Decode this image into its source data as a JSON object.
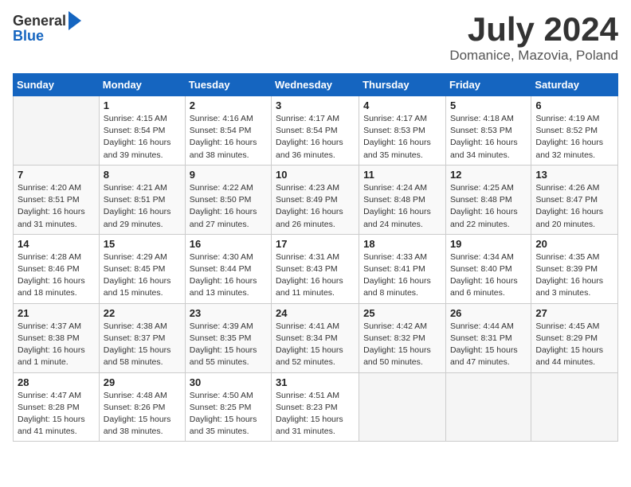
{
  "header": {
    "logo_line1": "General",
    "logo_line2": "Blue",
    "title": "July 2024",
    "location": "Domanice, Mazovia, Poland"
  },
  "calendar": {
    "days_of_week": [
      "Sunday",
      "Monday",
      "Tuesday",
      "Wednesday",
      "Thursday",
      "Friday",
      "Saturday"
    ],
    "weeks": [
      [
        {
          "num": "",
          "detail": ""
        },
        {
          "num": "1",
          "detail": "Sunrise: 4:15 AM\nSunset: 8:54 PM\nDaylight: 16 hours\nand 39 minutes."
        },
        {
          "num": "2",
          "detail": "Sunrise: 4:16 AM\nSunset: 8:54 PM\nDaylight: 16 hours\nand 38 minutes."
        },
        {
          "num": "3",
          "detail": "Sunrise: 4:17 AM\nSunset: 8:54 PM\nDaylight: 16 hours\nand 36 minutes."
        },
        {
          "num": "4",
          "detail": "Sunrise: 4:17 AM\nSunset: 8:53 PM\nDaylight: 16 hours\nand 35 minutes."
        },
        {
          "num": "5",
          "detail": "Sunrise: 4:18 AM\nSunset: 8:53 PM\nDaylight: 16 hours\nand 34 minutes."
        },
        {
          "num": "6",
          "detail": "Sunrise: 4:19 AM\nSunset: 8:52 PM\nDaylight: 16 hours\nand 32 minutes."
        }
      ],
      [
        {
          "num": "7",
          "detail": "Sunrise: 4:20 AM\nSunset: 8:51 PM\nDaylight: 16 hours\nand 31 minutes."
        },
        {
          "num": "8",
          "detail": "Sunrise: 4:21 AM\nSunset: 8:51 PM\nDaylight: 16 hours\nand 29 minutes."
        },
        {
          "num": "9",
          "detail": "Sunrise: 4:22 AM\nSunset: 8:50 PM\nDaylight: 16 hours\nand 27 minutes."
        },
        {
          "num": "10",
          "detail": "Sunrise: 4:23 AM\nSunset: 8:49 PM\nDaylight: 16 hours\nand 26 minutes."
        },
        {
          "num": "11",
          "detail": "Sunrise: 4:24 AM\nSunset: 8:48 PM\nDaylight: 16 hours\nand 24 minutes."
        },
        {
          "num": "12",
          "detail": "Sunrise: 4:25 AM\nSunset: 8:48 PM\nDaylight: 16 hours\nand 22 minutes."
        },
        {
          "num": "13",
          "detail": "Sunrise: 4:26 AM\nSunset: 8:47 PM\nDaylight: 16 hours\nand 20 minutes."
        }
      ],
      [
        {
          "num": "14",
          "detail": "Sunrise: 4:28 AM\nSunset: 8:46 PM\nDaylight: 16 hours\nand 18 minutes."
        },
        {
          "num": "15",
          "detail": "Sunrise: 4:29 AM\nSunset: 8:45 PM\nDaylight: 16 hours\nand 15 minutes."
        },
        {
          "num": "16",
          "detail": "Sunrise: 4:30 AM\nSunset: 8:44 PM\nDaylight: 16 hours\nand 13 minutes."
        },
        {
          "num": "17",
          "detail": "Sunrise: 4:31 AM\nSunset: 8:43 PM\nDaylight: 16 hours\nand 11 minutes."
        },
        {
          "num": "18",
          "detail": "Sunrise: 4:33 AM\nSunset: 8:41 PM\nDaylight: 16 hours\nand 8 minutes."
        },
        {
          "num": "19",
          "detail": "Sunrise: 4:34 AM\nSunset: 8:40 PM\nDaylight: 16 hours\nand 6 minutes."
        },
        {
          "num": "20",
          "detail": "Sunrise: 4:35 AM\nSunset: 8:39 PM\nDaylight: 16 hours\nand 3 minutes."
        }
      ],
      [
        {
          "num": "21",
          "detail": "Sunrise: 4:37 AM\nSunset: 8:38 PM\nDaylight: 16 hours\nand 1 minute."
        },
        {
          "num": "22",
          "detail": "Sunrise: 4:38 AM\nSunset: 8:37 PM\nDaylight: 15 hours\nand 58 minutes."
        },
        {
          "num": "23",
          "detail": "Sunrise: 4:39 AM\nSunset: 8:35 PM\nDaylight: 15 hours\nand 55 minutes."
        },
        {
          "num": "24",
          "detail": "Sunrise: 4:41 AM\nSunset: 8:34 PM\nDaylight: 15 hours\nand 52 minutes."
        },
        {
          "num": "25",
          "detail": "Sunrise: 4:42 AM\nSunset: 8:32 PM\nDaylight: 15 hours\nand 50 minutes."
        },
        {
          "num": "26",
          "detail": "Sunrise: 4:44 AM\nSunset: 8:31 PM\nDaylight: 15 hours\nand 47 minutes."
        },
        {
          "num": "27",
          "detail": "Sunrise: 4:45 AM\nSunset: 8:29 PM\nDaylight: 15 hours\nand 44 minutes."
        }
      ],
      [
        {
          "num": "28",
          "detail": "Sunrise: 4:47 AM\nSunset: 8:28 PM\nDaylight: 15 hours\nand 41 minutes."
        },
        {
          "num": "29",
          "detail": "Sunrise: 4:48 AM\nSunset: 8:26 PM\nDaylight: 15 hours\nand 38 minutes."
        },
        {
          "num": "30",
          "detail": "Sunrise: 4:50 AM\nSunset: 8:25 PM\nDaylight: 15 hours\nand 35 minutes."
        },
        {
          "num": "31",
          "detail": "Sunrise: 4:51 AM\nSunset: 8:23 PM\nDaylight: 15 hours\nand 31 minutes."
        },
        {
          "num": "",
          "detail": ""
        },
        {
          "num": "",
          "detail": ""
        },
        {
          "num": "",
          "detail": ""
        }
      ]
    ]
  }
}
